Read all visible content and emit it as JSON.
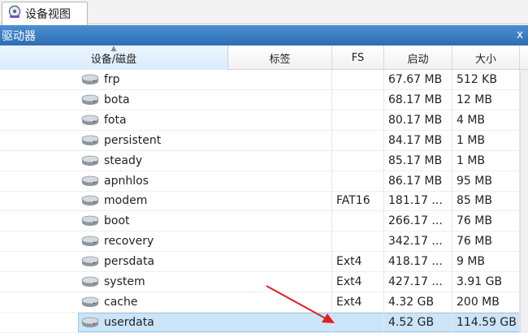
{
  "tab": {
    "label": "设备视图",
    "icon": "device-view-icon"
  },
  "panel": {
    "title": "驱动器",
    "close_icon": "x"
  },
  "columns": [
    {
      "label": "设备/磁盘"
    },
    {
      "label": "标签"
    },
    {
      "label": "FS"
    },
    {
      "label": "启动"
    },
    {
      "label": "大小"
    }
  ],
  "rows": [
    {
      "name": "frp",
      "label": "",
      "fs": "",
      "start": "67.67 MB",
      "size": "512 KB"
    },
    {
      "name": "bota",
      "label": "",
      "fs": "",
      "start": "68.17 MB",
      "size": "12 MB"
    },
    {
      "name": "fota",
      "label": "",
      "fs": "",
      "start": "80.17 MB",
      "size": "4 MB"
    },
    {
      "name": "persistent",
      "label": "",
      "fs": "",
      "start": "84.17 MB",
      "size": "1 MB"
    },
    {
      "name": "steady",
      "label": "",
      "fs": "",
      "start": "85.17 MB",
      "size": "1 MB"
    },
    {
      "name": "apnhlos",
      "label": "",
      "fs": "",
      "start": "86.17 MB",
      "size": "95 MB"
    },
    {
      "name": "modem",
      "label": "",
      "fs": "FAT16",
      "start": "181.17 ...",
      "size": "85 MB"
    },
    {
      "name": "boot",
      "label": "",
      "fs": "",
      "start": "266.17 ...",
      "size": "76 MB"
    },
    {
      "name": "recovery",
      "label": "",
      "fs": "",
      "start": "342.17 ...",
      "size": "76 MB"
    },
    {
      "name": "persdata",
      "label": "",
      "fs": "Ext4",
      "start": "418.17 ...",
      "size": "9 MB"
    },
    {
      "name": "system",
      "label": "",
      "fs": "Ext4",
      "start": "427.17 ...",
      "size": "3.91 GB"
    },
    {
      "name": "cache",
      "label": "",
      "fs": "Ext4",
      "start": "4.32 GB",
      "size": "200 MB"
    },
    {
      "name": "userdata",
      "label": "",
      "fs": "",
      "start": "4.52 GB",
      "size": "114.59 GB",
      "selected": true
    }
  ],
  "colors": {
    "header_blue": "#2e6db3",
    "selection": "#cce4f7",
    "arrow": "#e02020"
  }
}
